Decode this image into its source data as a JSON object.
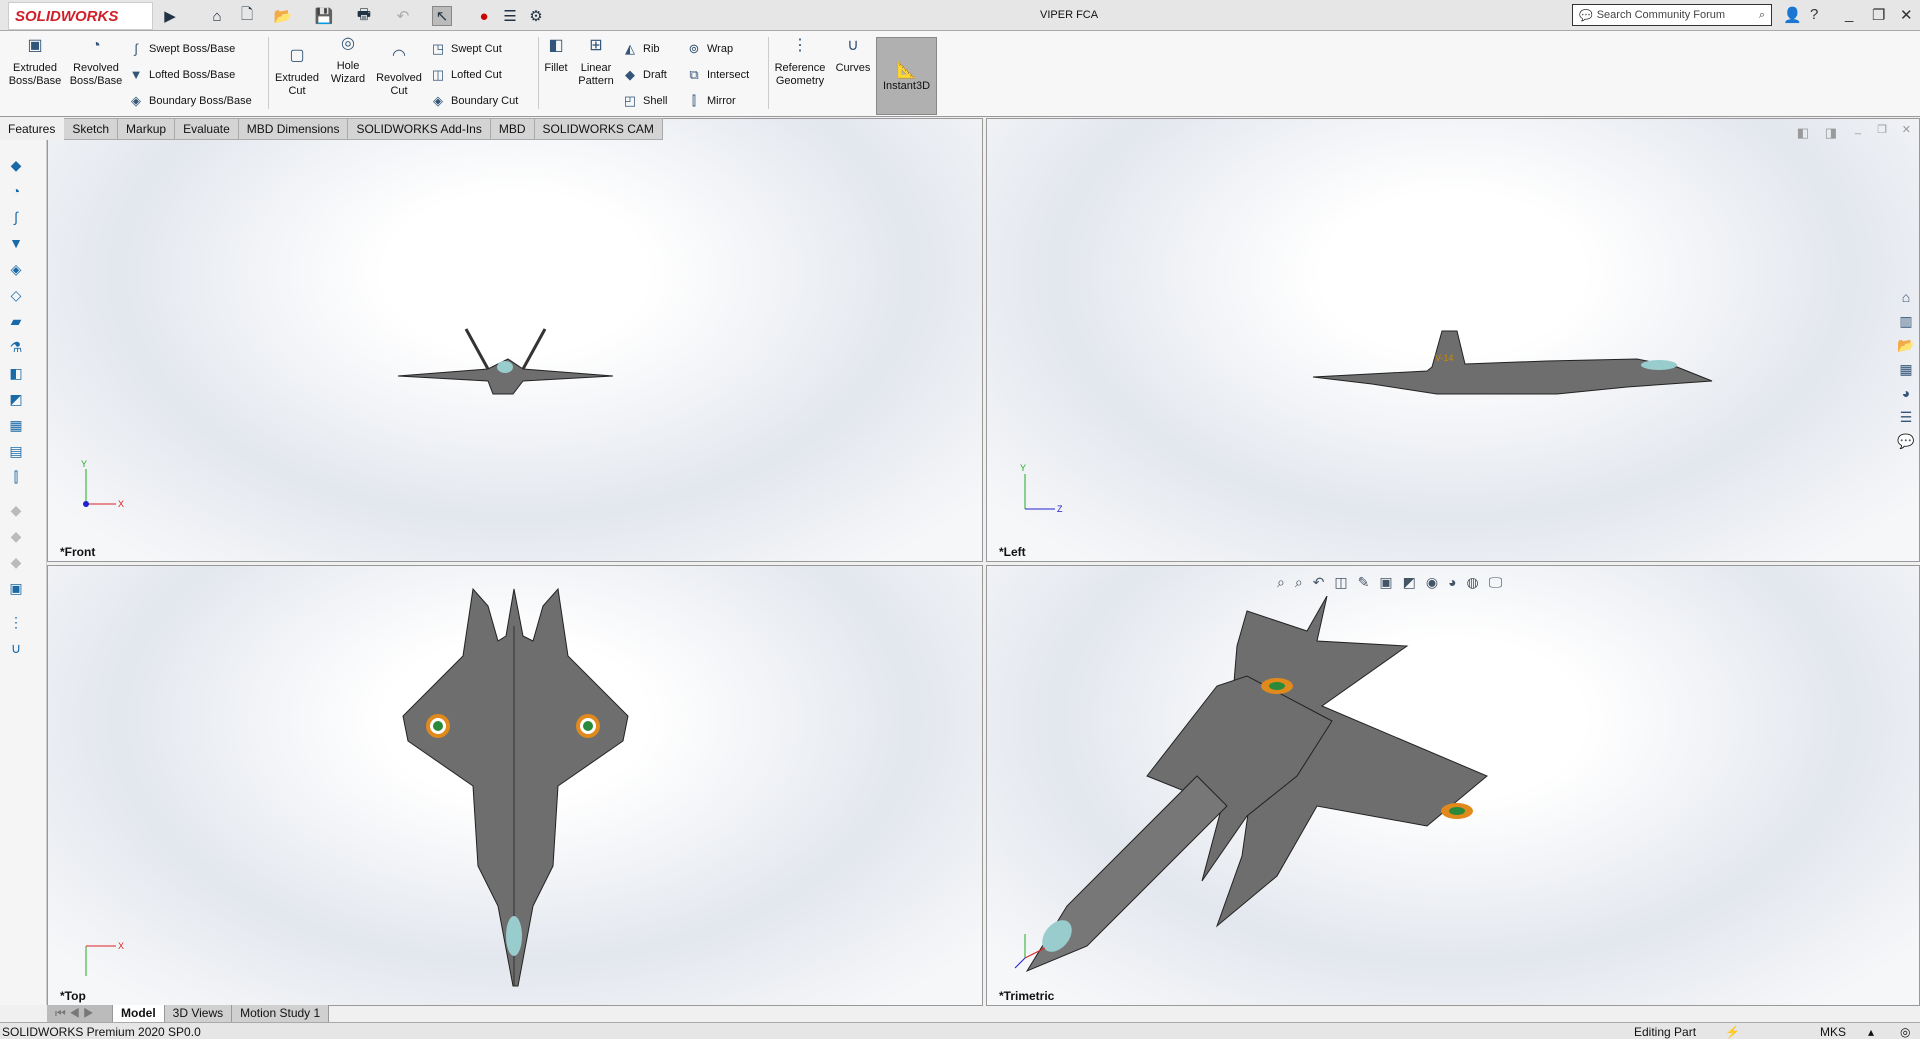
{
  "app": {
    "logo": "SOLIDWORKS",
    "title": "VIPER FCA"
  },
  "search": {
    "placeholder": "Search Community Forum"
  },
  "ribbon": {
    "extruded_boss": "Extruded Boss/Base",
    "revolved_boss": "Revolved Boss/Base",
    "swept_boss": "Swept Boss/Base",
    "lofted_boss": "Lofted Boss/Base",
    "boundary_boss": "Boundary Boss/Base",
    "extruded_cut": "Extruded Cut",
    "hole_wizard": "Hole Wizard",
    "revolved_cut": "Revolved Cut",
    "swept_cut": "Swept Cut",
    "lofted_cut": "Lofted Cut",
    "boundary_cut": "Boundary Cut",
    "fillet": "Fillet",
    "linear_pattern": "Linear Pattern",
    "rib": "Rib",
    "draft": "Draft",
    "shell": "Shell",
    "wrap": "Wrap",
    "intersect": "Intersect",
    "mirror": "Mirror",
    "reference_geometry": "Reference Geometry",
    "curves": "Curves",
    "instant3d": "Instant3D"
  },
  "tabs": [
    "Features",
    "Sketch",
    "Markup",
    "Evaluate",
    "MBD Dimensions",
    "SOLIDWORKS Add-Ins",
    "MBD",
    "SOLIDWORKS CAM"
  ],
  "viewports": {
    "front": "*Front",
    "left": "*Left",
    "top": "*Top",
    "trimetric": "*Trimetric"
  },
  "axes": {
    "x": "X",
    "y": "Y",
    "z": "Z"
  },
  "bottom_tabs": [
    "Model",
    "3D Views",
    "Motion Study 1"
  ],
  "status": {
    "product": "SOLIDWORKS Premium 2020 SP0.0",
    "mode": "Editing Part",
    "units": "MKS"
  },
  "colors": {
    "accent": "#d0202a",
    "aircraft": "#6e6e6e",
    "roundel_orange": "#e08a1e",
    "roundel_green": "#2a8a3a"
  }
}
